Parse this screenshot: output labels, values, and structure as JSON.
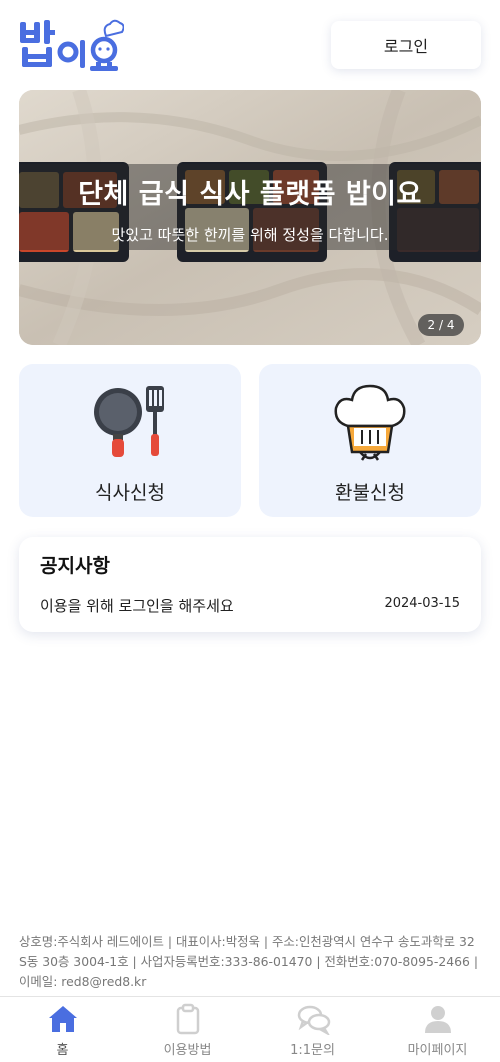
{
  "header": {
    "logo_text": "밥이요",
    "login_label": "로그인"
  },
  "banner": {
    "title": "단체 급식 식사 플랫폼 밥이요",
    "subtitle": "맛있고 따뜻한 한끼를 위해 정성을 다합니다.",
    "page_indicator": "2 / 4"
  },
  "cards": {
    "meal_label": "식사신청",
    "meal_icon": "frying-pan-spatula-icon",
    "refund_label": "환불신청",
    "refund_icon": "chef-hat-icon"
  },
  "notice": {
    "title": "공지사항",
    "items": [
      {
        "text": "이용을 위해 로그인을 해주세요",
        "date": "2024-03-15"
      }
    ]
  },
  "footer": {
    "company_info": "상호명:주식회사 레드에이트 | 대표이사:박정욱 | 주소:인천광역시 연수구 송도과학로 32 S동 30층 3004-1호 | 사업자등록번호:333-86-01470 | 전화번호:070-8095-2466 | 이메일: red8@red8.kr"
  },
  "tabbar": {
    "items": [
      {
        "label": "홈",
        "icon": "home-icon",
        "active": true
      },
      {
        "label": "이용방법",
        "icon": "clipboard-icon",
        "active": false
      },
      {
        "label": "1:1문의",
        "icon": "chat-bubbles-icon",
        "active": false
      },
      {
        "label": "마이페이지",
        "icon": "user-icon",
        "active": false
      }
    ]
  },
  "colors": {
    "brand_blue": "#4a6ee0",
    "card_bg": "#eef3fd",
    "tab_active": "#4a6ee0",
    "tab_inactive": "#d0d0d0"
  }
}
